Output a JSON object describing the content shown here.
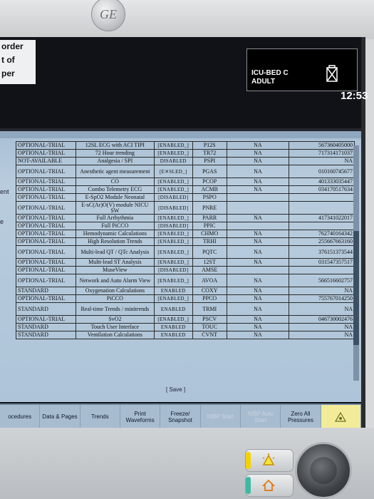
{
  "device": {
    "brand_logo": "GE"
  },
  "header": {
    "left_panel_lines": [
      "order",
      "t of",
      "per"
    ],
    "bed_line1": "ICU-BED C",
    "bed_line2": "ADULT",
    "clock": "12:53",
    "status_icon": "battery-disabled-icon"
  },
  "side_labels": [
    "ent",
    "e"
  ],
  "table": {
    "rows": [
      [
        "OPTIONAL-TRIAL",
        "12SL ECG with ACI TIPI",
        "[ENABLED_]",
        "P12S",
        "NA",
        "567360405000"
      ],
      [
        "OPTIONAL-TRIAL",
        "72 Hour trending",
        "[ENABLED_]",
        "TR72",
        "NA",
        "717314171037"
      ],
      [
        "NOT-AVAILABLE",
        "Analgesia / SPI",
        "DISABLED",
        "PSPI",
        "NA",
        "NA"
      ],
      [
        "OPTIONAL-TRIAL",
        "Anesthetic agent measurement",
        "[E✕SLED_]",
        "PGAS",
        "NA",
        "010160745677"
      ],
      [
        "OPTIONAL-TRIAL",
        "CO",
        "[ENABLED_]",
        "PCOP",
        "NA",
        "401333035447"
      ],
      [
        "OPTIONAL-TRIAL",
        "Combo Telemetry ECG",
        "[ENABLED_]",
        "ACMB",
        "NA",
        "034170517634"
      ],
      [
        "OPTIONAL-TRIAL",
        "E-SpO2 Module Neonatal",
        "[DISABLED]",
        "PSPO",
        "",
        ""
      ],
      [
        "OPTIONAL-TRIAL",
        "E-sC(Ar)O(V) module NICU SW",
        "[DISABLED]",
        "PNRE",
        "",
        ""
      ],
      [
        "OPTIONAL-TRIAL",
        "Full Arrhythmia",
        "[ENABLED_]",
        "PARR",
        "NA",
        "417341022017"
      ],
      [
        "OPTIONAL-TRIAL",
        "Full PiCCO",
        "[DISABLED]",
        "PPIC",
        "",
        ""
      ],
      [
        "OPTIONAL-TRIAL",
        "Hemodynamic Calculations",
        "[ENABLED_]",
        "CHMO",
        "NA",
        "762740164342"
      ],
      [
        "OPTIONAL-TRIAL",
        "High Resolution Trends",
        "[ENABLED_]",
        "TRHI",
        "NA",
        "255667663160"
      ],
      [
        "OPTIONAL-TRIAL",
        "Multi-lead QT / QTc Analysis",
        "[ENABLED_]",
        "PQTC",
        "NA",
        "376151373544"
      ],
      [
        "OPTIONAL-TRIAL",
        "Multi-lead ST Analysis",
        "[ENABLED_]",
        "12ST",
        "NA",
        "031547357517"
      ],
      [
        "OPTIONAL-TRIAL",
        "MuseView",
        "[DISABLED]",
        "AMSE",
        "",
        ""
      ],
      [
        "OPTIONAL-TRIAL",
        "Network and Auto Alarm View",
        "[ENABLED_]",
        "AVOA",
        "NA",
        "566516602757"
      ],
      [
        "STANDARD",
        "Oxygenation Calculations",
        "ENABLED",
        "COXY",
        "NA",
        "NA"
      ],
      [
        "OPTIONAL-TRIAL",
        "PiCCO",
        "[ENABLED_]",
        "PPCO",
        "NA",
        "755767014250"
      ],
      [
        "STANDARD",
        "Real-time Trends / minitrends",
        "ENABLED",
        "TRMI",
        "NA",
        "NA"
      ],
      [
        "OPTIONAL-TRIAL",
        "SvO2",
        "[ENABLED_]",
        "PSCV",
        "NA",
        "046730002476"
      ],
      [
        "STANDARD",
        "Touch User Interface",
        "ENABLED",
        "TOUC",
        "NA",
        "NA"
      ],
      [
        "STANDARD",
        "Ventilation Calculations",
        "ENABLED",
        "CVNT",
        "NA",
        "NA"
      ]
    ],
    "save_label": "[ Save ]"
  },
  "softkeys": [
    {
      "label": "ocedures",
      "enabled": true
    },
    {
      "label": "Data & Pages",
      "enabled": true
    },
    {
      "label": "Trends",
      "enabled": true
    },
    {
      "label": "Print Waveforms",
      "enabled": true
    },
    {
      "label": "Freeze/ Snapshot",
      "enabled": true
    },
    {
      "label": "NIBP Start",
      "enabled": false
    },
    {
      "label": "NIBP Auto Start",
      "enabled": false
    },
    {
      "label": "Zero All Pressures",
      "enabled": true
    },
    {
      "label": "",
      "enabled": true,
      "icon": "alarm-bell-icon"
    }
  ],
  "colors": {
    "panel_bg": "#b8ccdd",
    "softkey_bg": "#a8bcd0",
    "alarm_key_bg": "#f2ec9a",
    "led_yellow": "#f2d300",
    "led_green": "#3fb9a3"
  }
}
